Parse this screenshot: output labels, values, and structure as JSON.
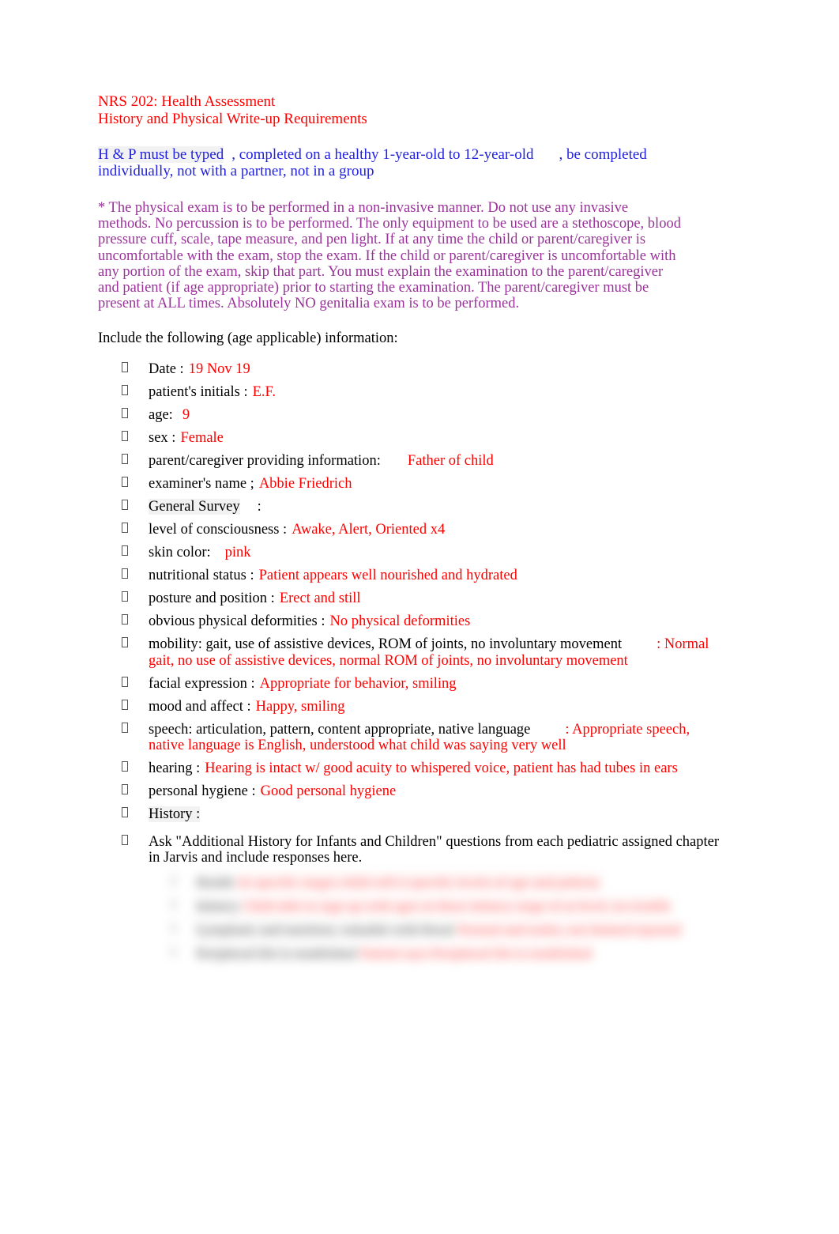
{
  "document": {
    "header": {
      "line1": "NRS 202: Health Assessment",
      "line2": "History and Physical Write-up Requirements"
    },
    "requirement": {
      "part1": "H & P must be typed",
      "part2": ", completed on a healthy 1-year-old to 12-year-old",
      "part3": ", be completed individually, not with a partner, not in a group"
    },
    "note": "* The physical exam is to be performed in a non-invasive manner. Do not use any invasive methods. No percussion is to be performed. The only equipment to be used are a stethoscope, blood pressure cuff, scale, tape measure, and pen light. If at any time the child or parent/caregiver is uncomfortable with the exam, stop the exam. If the child or parent/caregiver is uncomfortable with any portion of the exam, skip that part. You must explain the examination to the parent/caregiver and patient (if age appropriate) prior to starting the examination. The parent/caregiver must be present at ALL times. Absolutely NO genitalia exam is to be performed.",
    "include_intro": "Include the following (age applicable) information:",
    "items": [
      {
        "label": "Date :",
        "answer": "19 Nov 19",
        "gap": 6
      },
      {
        "label": "patient's initials  :",
        "answer": "E.F.",
        "gap": 6
      },
      {
        "label": "age:",
        "answer": "9",
        "gap": 12
      },
      {
        "label": "sex :",
        "answer": "Female",
        "gap": 6
      },
      {
        "label": "parent/caregiver providing information:",
        "answer": "Father of child",
        "gap": 34
      },
      {
        "label": "examiner's name   ;",
        "answer": "Abbie Friedrich",
        "gap": 6
      },
      {
        "label": "General Survey",
        "answer": "",
        "suffix": ":",
        "highlight": true,
        "gap": 22
      },
      {
        "label": "level of consciousness     :",
        "answer": "Awake, Alert, Oriented x4",
        "gap": 6
      },
      {
        "label": "skin color:",
        "answer": "pink",
        "gap": 18
      },
      {
        "label": "nutritional status  :",
        "answer": "Patient appears well nourished and hydrated",
        "gap": 6
      },
      {
        "label": "posture and position    :",
        "answer": "Erect and still",
        "gap": 6
      },
      {
        "label": "obvious physical deformities    :",
        "answer": "No physical deformities",
        "gap": 6
      },
      {
        "label": "mobility: gait, use of assistive devices, ROM of joints, no involuntary movement",
        "answer": ": Normal gait, no use of assistive devices, normal ROM of joints, no involuntary movement",
        "gap": 44
      },
      {
        "label": "facial expression   :",
        "answer": "Appropriate for behavior, smiling",
        "gap": 6
      },
      {
        "label": "mood and affect   :",
        "answer": "Happy, smiling",
        "gap": 6
      },
      {
        "label": "speech: articulation, pattern, content appropriate, native language",
        "answer": ": Appropriate speech, native language is English, understood what child was saying very well",
        "gap": 44
      },
      {
        "label": "hearing  :",
        "answer": "Hearing is intact w/ good acuity to whispered voice, patient has had tubes in ears",
        "gap": 6
      },
      {
        "label": "personal hygiene    :",
        "answer": "Good personal hygiene",
        "gap": 6
      },
      {
        "label": "History  :",
        "answer": "",
        "highlight": true,
        "gap": 6
      },
      {
        "label": "Ask \"Additional History for Infants and Children\" questions from each pediatric assigned chapter in Jarvis and include responses here.",
        "answer": "",
        "gap": 0
      }
    ],
    "redacted_note": "illegible blurred sub-list of four items",
    "colors": {
      "header_red": "#ff0000",
      "requirement_blue": "#2222dd",
      "note_purple": "#993399",
      "answer_red": "#ff0000",
      "label_black": "#000000",
      "highlight_gray": "#f2f2f2",
      "page_background": "#ffffff"
    }
  }
}
